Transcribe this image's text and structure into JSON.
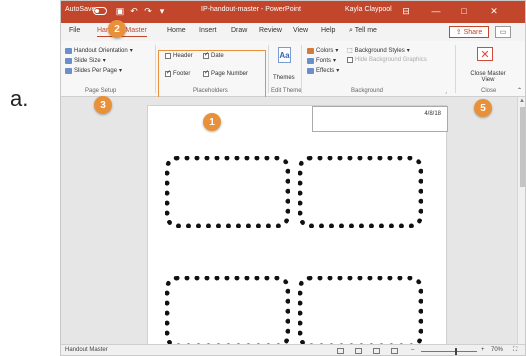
{
  "outer_label": "a.",
  "titlebar": {
    "autosave_label": "AutoSave",
    "doc_title": "IP-handout-master - PowerPoint",
    "user_name": "Kayla Claypool",
    "icons": [
      "save-icon",
      "undo-icon",
      "redo-icon",
      "customize-icon",
      "ribbon-display-icon",
      "minimize-icon",
      "restore-icon",
      "close-icon"
    ],
    "minimize_glyph": "—",
    "restore_glyph": "□",
    "close_glyph": "✕"
  },
  "tabs": {
    "file": "File",
    "handout_master": "Handout Master",
    "home": "Home",
    "insert": "Insert",
    "draw": "Draw",
    "review": "Review",
    "view": "View",
    "help": "Help",
    "tell_me": "Tell me",
    "share": "Share"
  },
  "ribbon": {
    "page_setup": {
      "handout_orientation": "Handout Orientation",
      "slide_size": "Slide Size",
      "slides_per_page": "Slides Per Page",
      "label": "Page Setup"
    },
    "placeholders": {
      "header": "Header",
      "header_checked": false,
      "date": "Date",
      "date_checked": true,
      "footer": "Footer",
      "footer_checked": true,
      "page_number": "Page Number",
      "page_number_checked": true,
      "label": "Placeholders"
    },
    "edit_theme": {
      "themes": "Themes",
      "label": "Edit Theme"
    },
    "background": {
      "colors": "Colors",
      "fonts": "Fonts",
      "effects": "Effects",
      "background_styles": "Background Styles",
      "hide_background_graphics": "Hide Background Graphics",
      "label": "Background"
    },
    "close": {
      "close_master_view": "Close Master View",
      "label": "Close"
    }
  },
  "badges": [
    "1",
    "2",
    "3",
    "5"
  ],
  "slide": {
    "date_text": "4/8/18"
  },
  "statusbar": {
    "mode": "Handout Master",
    "zoom": "70%"
  },
  "colors": {
    "accent": "#c2462b",
    "callout": "#e8913a"
  }
}
